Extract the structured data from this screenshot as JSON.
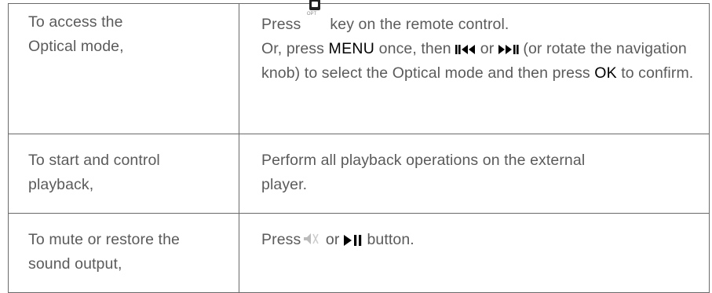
{
  "rows": [
    {
      "action": "To access the Optical mode,",
      "line1_pre": "Press ",
      "line1_key_label": "OPT",
      "line1_post": " key on the remote control.",
      "line2_pre": "Or, press ",
      "line2_menu": "MENU",
      "line2_mid": " once, then ",
      "line2_or": " or ",
      "line2_post": " (or rotate the navigation knob) to select the Optical mode and then press ",
      "line2_ok": "OK",
      "line2_end": " to confirm.",
      "icon_prev": "skip-previous-icon",
      "icon_next": "skip-next-icon",
      "icon_key": "optical-key-icon"
    },
    {
      "action": "To start and control playback,",
      "instruction": "Perform all playback operations on the external player."
    },
    {
      "action": "To mute or restore the sound output,",
      "pre": "Press",
      "or": " or ",
      "post": "  button.",
      "icon_mute": "mute-icon",
      "icon_play": "play-pause-icon"
    }
  ]
}
